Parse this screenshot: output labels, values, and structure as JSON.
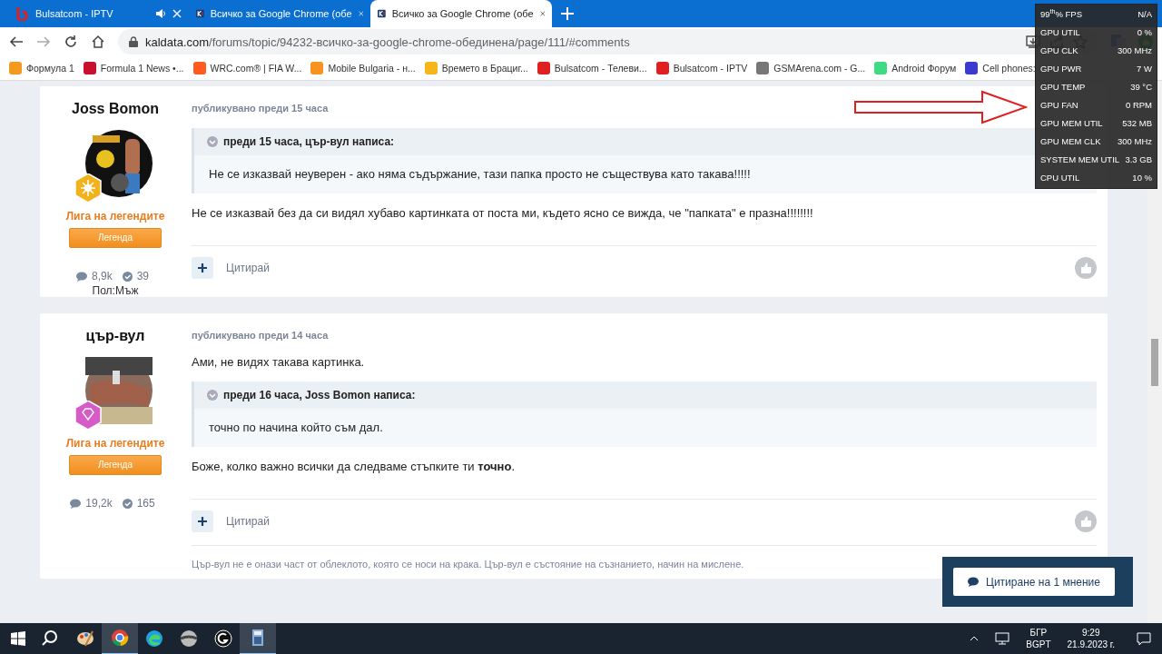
{
  "tabs": [
    {
      "kind": "bulsat",
      "title": "Bulsatcom - IPTV",
      "audio": true,
      "selected": false
    },
    {
      "kind": "kaldata",
      "title": "Всичко за Google Chrome (обе",
      "audio": false,
      "selected": false
    },
    {
      "kind": "kaldata",
      "title": "Всичко за Google Chrome (обе",
      "audio": false,
      "selected": true
    }
  ],
  "address": {
    "domain": "kaldata.com",
    "path": "/forums/topic/94232-всичко-за-google-chrome-обединена/page/111/#comments"
  },
  "bookmarks": [
    {
      "label": "Формула 1",
      "color": "#f39a1e"
    },
    {
      "label": "Formula 1 News •...",
      "color": "#c8102e"
    },
    {
      "label": "WRC.com® | FIA W...",
      "color": "#ff5a1f"
    },
    {
      "label": "Mobile Bulgaria - н...",
      "color": "#f7931e"
    },
    {
      "label": "Времето в Брациг...",
      "color": "#f5b51b"
    },
    {
      "label": "Bulsatcom - Телеви...",
      "color": "#e02020"
    },
    {
      "label": "Bulsatcom - IPTV",
      "color": "#e02020"
    },
    {
      "label": "GSMArena.com - G...",
      "color": "#777777"
    },
    {
      "label": "Android Форум",
      "color": "#3ddc84"
    },
    {
      "label": "Cell phones:",
      "color": "#3a3ad0"
    }
  ],
  "posts": [
    {
      "author": "Joss Bomon",
      "badge": {
        "kind": "sun"
      },
      "rank": "Лига на легендите",
      "group": "Легенда",
      "posts": "8,9k",
      "reputation": "39",
      "gender": "Пол:Мъж",
      "meta": "публикувано преди 15 часа",
      "blocks": [
        {
          "kind": "quote",
          "header": "преди 15 часа, цър-вул написа:",
          "body": "Не се изказвай неуверен - ако няма съдържание, тази папка просто не съществува като такава!!!!!"
        },
        {
          "kind": "text",
          "text": "Не се изказвай без да си видял хубаво картинката от поста ми, където ясно се вижда, че \"папката\" е празна!!!!!!!!"
        }
      ],
      "quote_label": "Цитирай"
    },
    {
      "author": "цър-вул",
      "badge": {
        "kind": "gem"
      },
      "rank": "Лига на легендите",
      "group": "Легенда",
      "posts": "19,2k",
      "reputation": "165",
      "meta": "публикувано преди 14 часа",
      "blocks": [
        {
          "kind": "text",
          "text": "Ами, не видях такава картинка."
        },
        {
          "kind": "quote",
          "header": "преди 16 часа, Joss Bomon написа:",
          "body": "точно по начина който съм дал."
        },
        {
          "kind": "text",
          "text": "Боже, колко важно всички да следваме стъпките ти **точно**."
        }
      ],
      "quote_label": "Цитирай",
      "signature": "Цър-вул не е онази част от облеклото, която се носи на крака. Цър-вул е състояние на съзнанието, начин на мислене."
    }
  ],
  "overlay": [
    {
      "label": "99$^{th}$% FPS",
      "value": "N/A"
    },
    {
      "label": "GPU UTIL",
      "value": "0 %"
    },
    {
      "label": "GPU CLK",
      "value": "300 MHz"
    },
    {
      "label": "GPU PWR",
      "value": "7 W"
    },
    {
      "label": "GPU TEMP",
      "value": "39 °C"
    },
    {
      "label": "GPU FAN",
      "value": "0 RPM"
    },
    {
      "label": "GPU MEM UTIL",
      "value": "532 MB"
    },
    {
      "label": "GPU MEM CLK",
      "value": "300 MHz"
    },
    {
      "label": "SYSTEM MEM UTIL",
      "value": "3.3 GB"
    },
    {
      "label": "CPU UTIL",
      "value": "10 %"
    }
  ],
  "quote_popup": {
    "label": "Цитиране на 1 мнение"
  },
  "taskbar": {
    "apps": [
      {
        "kind": "search",
        "selected": false
      },
      {
        "kind": "paint",
        "selected": false
      },
      {
        "kind": "chrome",
        "selected": true
      },
      {
        "kind": "edge",
        "selected": false
      },
      {
        "kind": "disc",
        "selected": false
      },
      {
        "kind": "g",
        "selected": false
      },
      {
        "kind": "calculator",
        "selected": true
      }
    ],
    "lang": "БГР",
    "layout": "BGPT",
    "time": "9:29",
    "date": "21.9.2023 г."
  }
}
